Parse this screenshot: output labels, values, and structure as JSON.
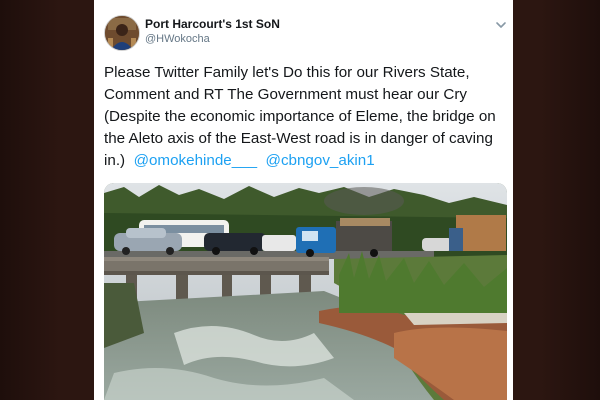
{
  "colors": {
    "link": "#1da1f2",
    "text": "#14171a",
    "secondary": "#657786",
    "backdrop": "#2a140f"
  },
  "author": {
    "display_name": "Port Harcourt's 1st SoN",
    "handle": "@HWokocha",
    "avatar_icon": "avatar-icon"
  },
  "menu": {
    "icon": "chevron-down-icon"
  },
  "tweet": {
    "text": "Please Twitter Family let's Do this for our Rivers State, Comment and RT The Government must hear our Cry (Despite the economic importance of Eleme, the bridge on the Aleto axis of the East-West road is in danger of caving in.)",
    "mentions": [
      "@omokehinde___",
      "@cbngov_akin1"
    ]
  },
  "media": {
    "icon": "bridge-photo"
  }
}
